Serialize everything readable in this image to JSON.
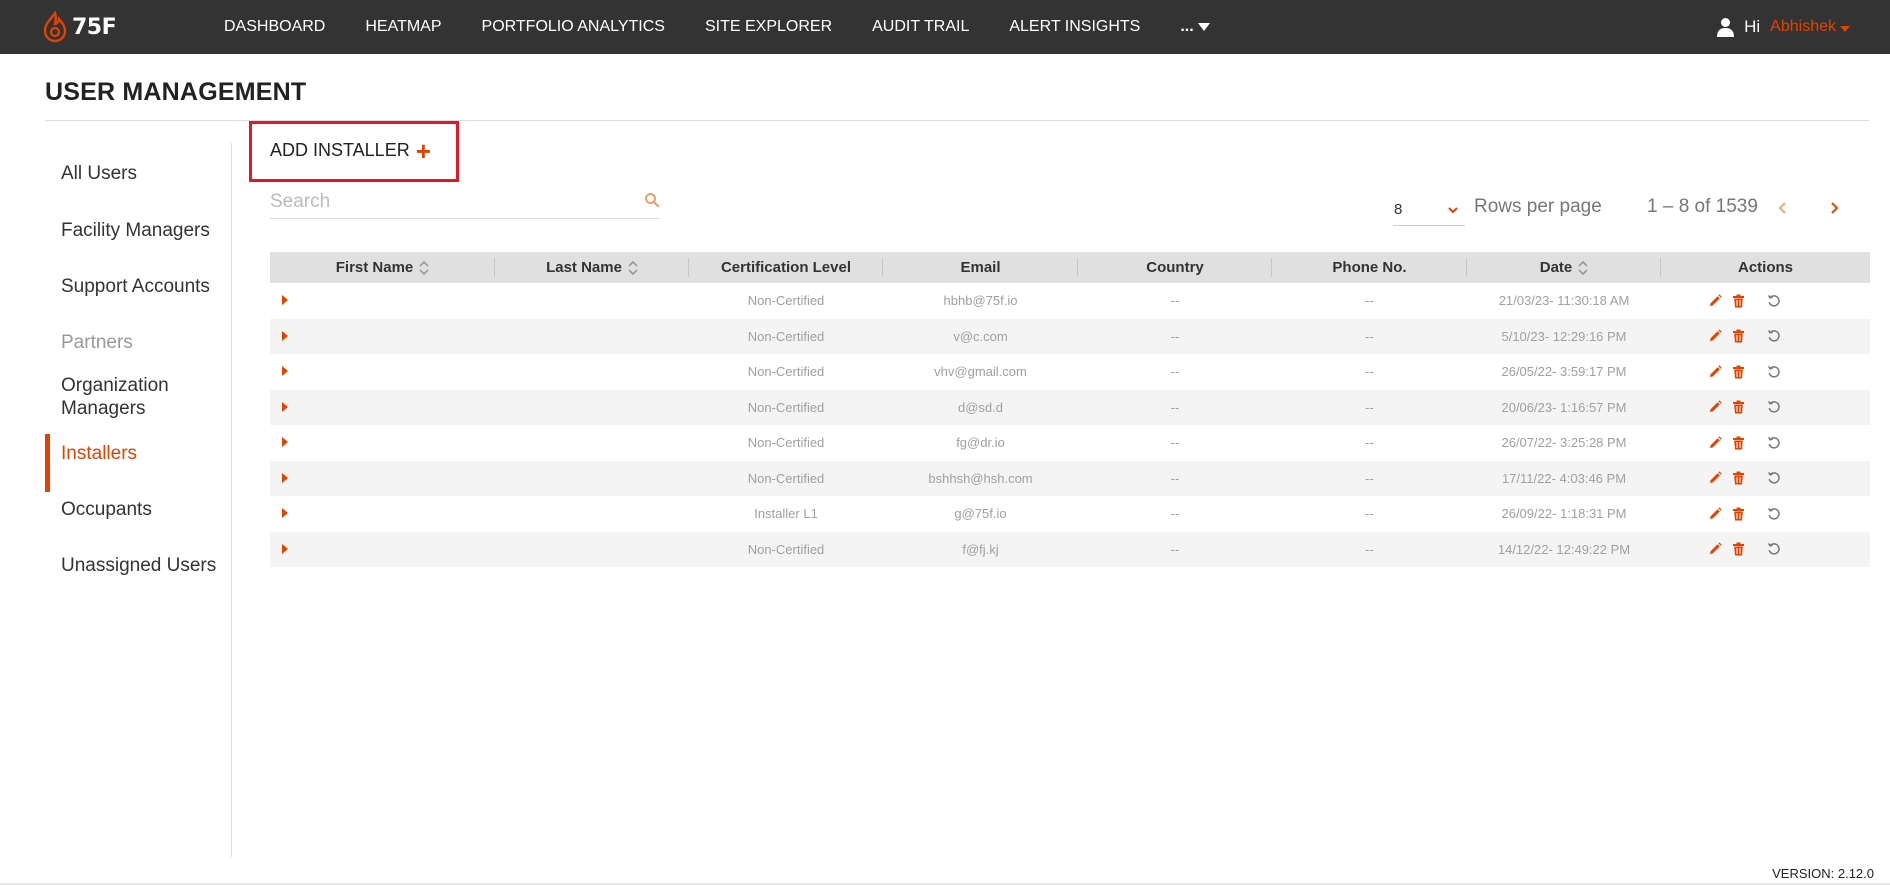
{
  "app": {
    "logo_text": "75F",
    "brand_color": "#e24301"
  },
  "nav": {
    "items": [
      "DASHBOARD",
      "HEATMAP",
      "PORTFOLIO ANALYTICS",
      "SITE EXPLORER",
      "AUDIT TRAIL",
      "ALERT INSIGHTS"
    ],
    "more_label": "..."
  },
  "user": {
    "greeting": "Hi",
    "name": "Abhishek"
  },
  "page": {
    "title": "USER MANAGEMENT"
  },
  "sidebar": {
    "items": [
      {
        "label": "All Users",
        "state": "normal"
      },
      {
        "label": "Facility Managers",
        "state": "normal"
      },
      {
        "label": "Support Accounts",
        "state": "normal"
      },
      {
        "label": "Partners",
        "state": "muted"
      },
      {
        "label": "Organization Managers",
        "state": "normal"
      },
      {
        "label": "Installers",
        "state": "active"
      },
      {
        "label": "Occupants",
        "state": "normal"
      },
      {
        "label": "Unassigned Users",
        "state": "normal"
      }
    ]
  },
  "toolbar": {
    "add_label": "ADD INSTALLER",
    "add_icon": "+",
    "search_placeholder": "Search"
  },
  "pagination": {
    "rows_per_page_value": "8",
    "rows_per_page_label": "Rows per page",
    "range": "1 – 8 of 1539"
  },
  "table": {
    "columns": [
      {
        "label": "First Name",
        "sortable": true
      },
      {
        "label": "Last Name",
        "sortable": true
      },
      {
        "label": "Certification Level",
        "sortable": false
      },
      {
        "label": "Email",
        "sortable": false
      },
      {
        "label": "Country",
        "sortable": false
      },
      {
        "label": "Phone No.",
        "sortable": false
      },
      {
        "label": "Date",
        "sortable": true
      },
      {
        "label": "Actions",
        "sortable": false
      }
    ],
    "rows": [
      {
        "first": "",
        "last": "",
        "cert": "Non-Certified",
        "email": "hbhb@75f.io",
        "country": "--",
        "phone": "--",
        "date": "21/03/23- 11:30:18 AM"
      },
      {
        "first": "",
        "last": "",
        "cert": "Non-Certified",
        "email": "v@c.com",
        "country": "--",
        "phone": "--",
        "date": "5/10/23- 12:29:16 PM"
      },
      {
        "first": "",
        "last": "",
        "cert": "Non-Certified",
        "email": "vhv@gmail.com",
        "country": "--",
        "phone": "--",
        "date": "26/05/22- 3:59:17 PM"
      },
      {
        "first": "",
        "last": "",
        "cert": "Non-Certified",
        "email": "d@sd.d",
        "country": "--",
        "phone": "--",
        "date": "20/06/23- 1:16:57 PM"
      },
      {
        "first": "",
        "last": "",
        "cert": "Non-Certified",
        "email": "fg@dr.io",
        "country": "--",
        "phone": "--",
        "date": "26/07/22- 3:25:28 PM"
      },
      {
        "first": "",
        "last": "",
        "cert": "Non-Certified",
        "email": "bshhsh@hsh.com",
        "country": "--",
        "phone": "--",
        "date": "17/11/22- 4:03:46 PM"
      },
      {
        "first": "",
        "last": "",
        "cert": "Installer L1",
        "email": "g@75f.io",
        "country": "--",
        "phone": "--",
        "date": "26/09/22- 1:18:31 PM"
      },
      {
        "first": "",
        "last": "",
        "cert": "Non-Certified",
        "email": "f@fj.kj",
        "country": "--",
        "phone": "--",
        "date": "14/12/22- 12:49:22 PM"
      }
    ]
  },
  "footer": {
    "version": "VERSION: 2.12.0"
  }
}
